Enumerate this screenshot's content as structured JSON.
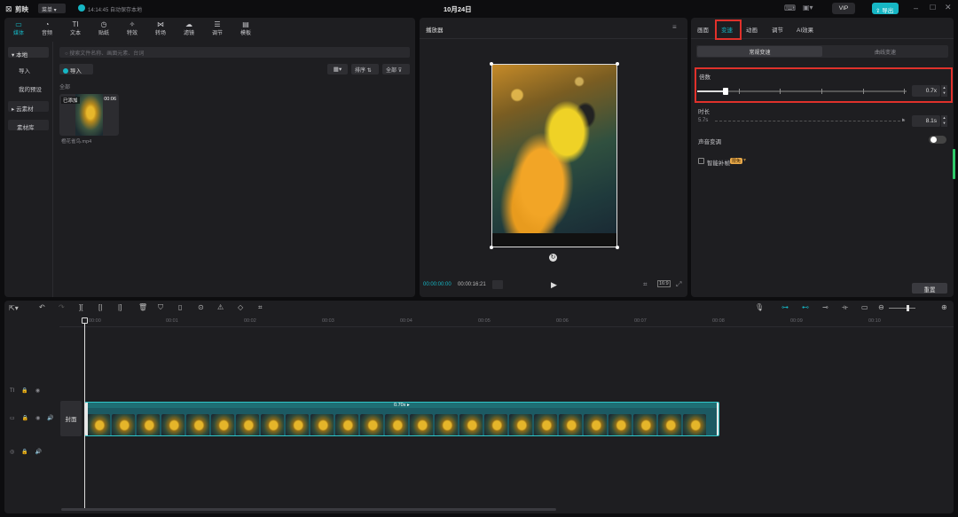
{
  "titlebar": {
    "app_name": "剪映",
    "menu_label": "菜单",
    "autosave": "14:14:45 自动保存本地",
    "project_title": "10月24日",
    "vip": "VIP",
    "export_label": "导出"
  },
  "media_tabs": [
    {
      "label": "媒体",
      "icon": "media-icon",
      "active": true
    },
    {
      "label": "音频",
      "icon": "audio-icon"
    },
    {
      "label": "文本",
      "icon": "text-icon",
      "glyph": "TI"
    },
    {
      "label": "贴纸",
      "icon": "sticker-icon"
    },
    {
      "label": "特效",
      "icon": "effects-icon"
    },
    {
      "label": "转场",
      "icon": "transition-icon"
    },
    {
      "label": "滤镜",
      "icon": "filter-icon"
    },
    {
      "label": "调节",
      "icon": "adjust-icon"
    },
    {
      "label": "模板",
      "icon": "template-icon"
    }
  ],
  "media_sidebar": {
    "local": "本地",
    "import": "导入",
    "my_presets": "我的预设",
    "cloud": "云素材",
    "library": "素材库"
  },
  "media_panel": {
    "search_placeholder": "搜索文件名称、画面元素、台词",
    "import_button": "导入",
    "sort_label": "排序",
    "filter_label": "全部",
    "section_label": "全部",
    "clip": {
      "badge": "已添加",
      "duration": "00:06",
      "filename": "橙花雀鸟.mp4"
    }
  },
  "player": {
    "title": "播放器",
    "current_time": "00:00:00:00",
    "total_time": "00:00:16:21",
    "ratio_label": "比例"
  },
  "inspector": {
    "tabs": [
      {
        "label": "画面"
      },
      {
        "label": "变速",
        "active": true
      },
      {
        "label": "动画"
      },
      {
        "label": "调节"
      },
      {
        "label": "AI效果"
      }
    ],
    "subtabs": [
      {
        "label": "常规变速",
        "active": true
      },
      {
        "label": "曲线变速"
      }
    ],
    "speed": {
      "label": "倍数",
      "value": "0.7x",
      "fraction": 0.04
    },
    "duration": {
      "label": "时长",
      "from": "5.7s",
      "to": "8.1s"
    },
    "audio_pitch": {
      "label": "声音变调"
    },
    "smooth": {
      "label": "智能补帧",
      "badge": "限免"
    },
    "reset_button": "重置"
  },
  "timeline": {
    "ruler": [
      "00:00",
      "00:01",
      "00:02",
      "00:03",
      "00:04",
      "00:05",
      "00:06",
      "00:07",
      "00:08",
      "00:09",
      "00:10"
    ],
    "clip_speed_label": "0.70x",
    "cover_label": "封面"
  },
  "colors": {
    "accent": "#16b6c4",
    "clip_border": "#2fc7c9",
    "highlight_box": "#e0312b"
  }
}
